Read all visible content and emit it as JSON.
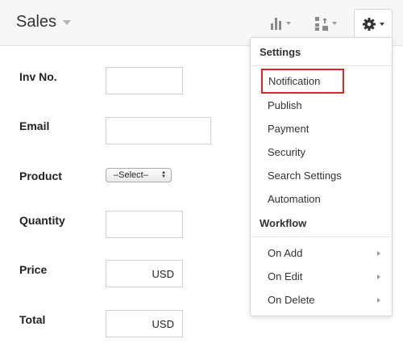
{
  "header": {
    "title": "Sales",
    "chart_icon": "bar-chart-icon",
    "layout_icon": "layout-arrows-icon",
    "settings_icon": "gear-icon"
  },
  "form": {
    "inv_no": {
      "label": "Inv No.",
      "value": ""
    },
    "email": {
      "label": "Email",
      "value": ""
    },
    "product": {
      "label": "Product",
      "selected": "–Select–"
    },
    "quantity": {
      "label": "Quantity",
      "value": ""
    },
    "price": {
      "label": "Price",
      "currency": "USD"
    },
    "total": {
      "label": "Total",
      "currency": "USD"
    }
  },
  "settings_menu": {
    "settings_heading": "Settings",
    "settings_items": [
      "Notification",
      "Publish",
      "Payment",
      "Security",
      "Search Settings",
      "Automation"
    ],
    "highlighted_item": "Notification",
    "highlight_color": "#d9262c",
    "workflow_heading": "Workflow",
    "workflow_items": [
      "On Add",
      "On Edit",
      "On Delete"
    ]
  }
}
